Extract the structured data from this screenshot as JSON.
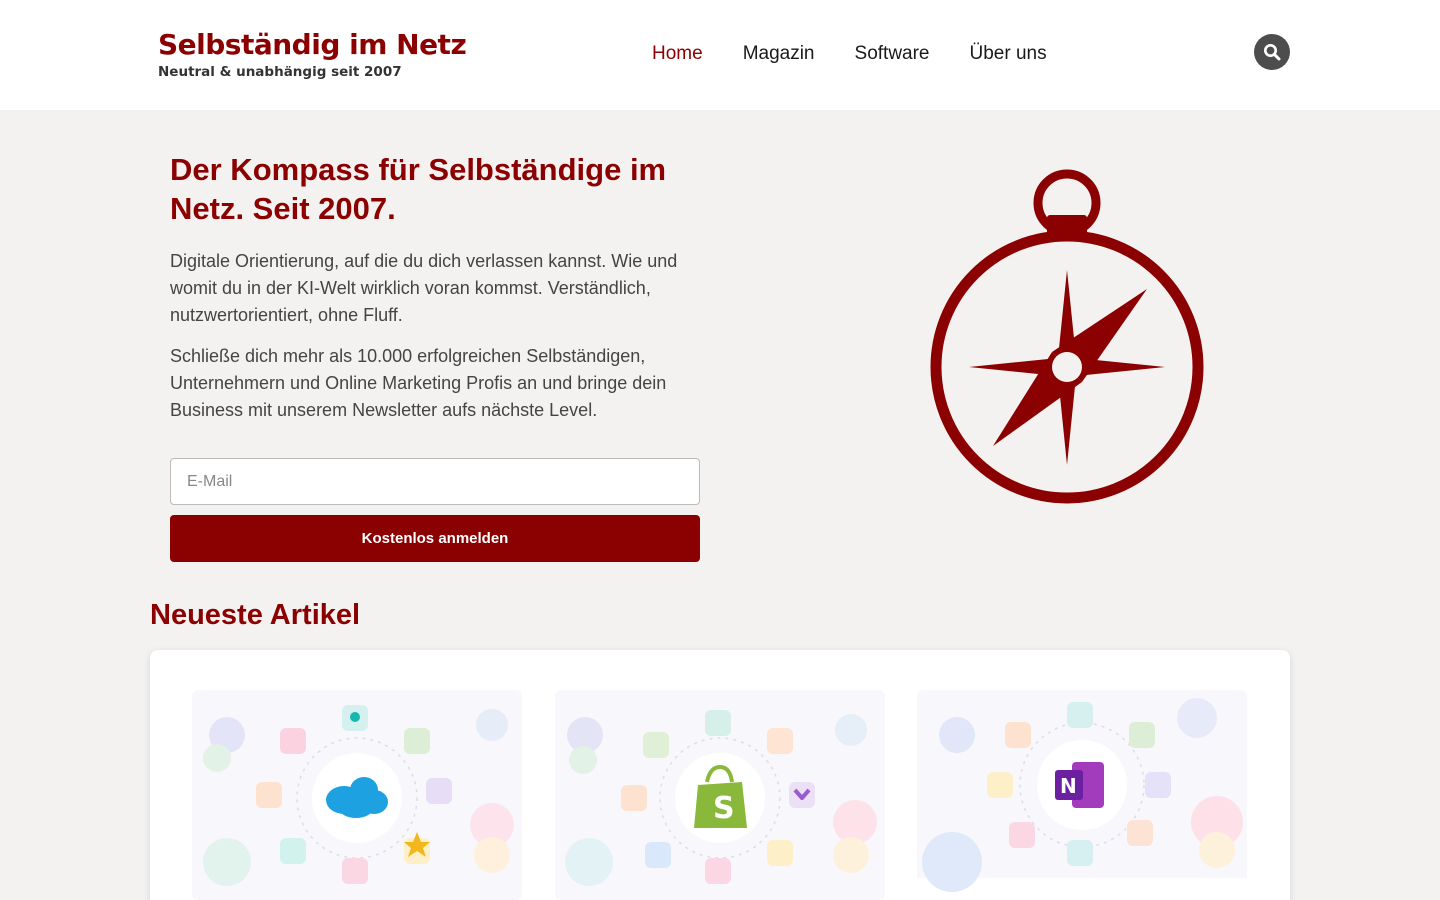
{
  "header": {
    "logo_title": "Selbständig im Netz",
    "logo_tagline": "Neutral & unabhängig seit 2007",
    "nav": [
      {
        "label": "Home",
        "active": true
      },
      {
        "label": "Magazin",
        "active": false
      },
      {
        "label": "Software",
        "active": false
      },
      {
        "label": "Über uns",
        "active": false
      }
    ],
    "search_icon": "search-icon"
  },
  "hero": {
    "title": "Der Kompass für Selbständige im Netz. Seit 2007.",
    "paragraph1": "Digitale Orientierung, auf die du dich verlassen kannst. Wie und womit du in der KI-Welt wirklich voran kommst. Verständlich, nutzwertorientiert, ohne Fluff.",
    "paragraph2": "Schließe dich mehr als 10.000 erfolgreichen Selbständigen, Unternehmern und Online Marketing Profis an und bringe dein Business mit unserem Newsletter aufs nächste Level.",
    "email_placeholder": "E-Mail",
    "email_value": "",
    "submit_label": "Kostenlos anmelden",
    "illustration": "compass-icon"
  },
  "articles": {
    "title": "Neueste Artikel",
    "items": [
      {
        "thumbnail": "salesforce-thumbnail"
      },
      {
        "thumbnail": "shopify-thumbnail"
      },
      {
        "thumbnail": "onenote-thumbnail"
      }
    ]
  },
  "colors": {
    "brand": "#8b0000",
    "background": "#f4f2f1",
    "header_bg": "#ffffff",
    "search_button": "#4d4d4d"
  }
}
